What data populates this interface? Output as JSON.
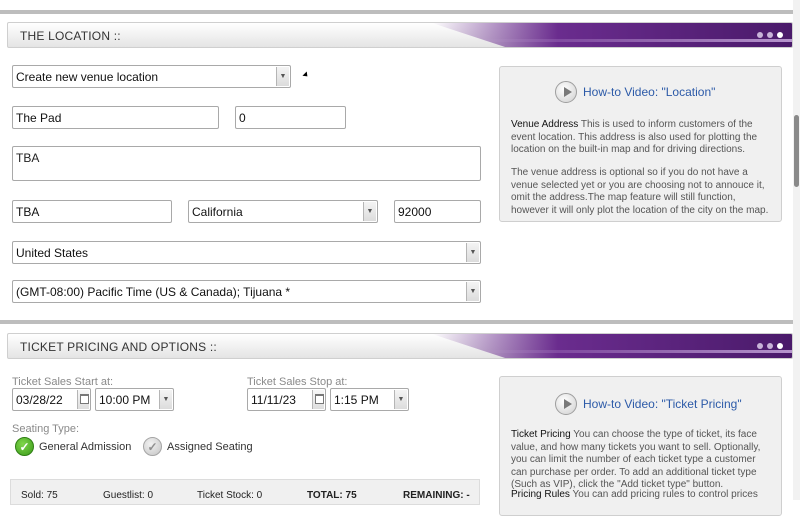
{
  "location": {
    "title": "THE LOCATION ::",
    "venue_select": "Create new venue location",
    "venue_name": "The Pad",
    "capacity": "0",
    "address": "TBA",
    "city": "TBA",
    "state": "California",
    "zip": "92000",
    "country": "United States",
    "timezone": "(GMT-08:00) Pacific Time (US & Canada); Tijuana *",
    "help": {
      "video_label": "How-to Video: \"Location\"",
      "para1_term": "Venue Address",
      "para1_text": " This is used to inform customers of the event location. This address is also used for plotting the location on the built-in map and for driving directions.",
      "para2_text": "The venue address is optional so if you do not have a venue selected yet or you are choosing not to annouce it, omit the address.The map feature will still function, however it will only plot the location of the city on the map."
    }
  },
  "pricing": {
    "title": "TICKET PRICING AND OPTIONS ::",
    "start_label": "Ticket Sales Start at:",
    "start_date": "03/28/22",
    "start_time": "10:00 PM",
    "stop_label": "Ticket Sales Stop at:",
    "stop_date": "11/11/23",
    "stop_time": "1:15 PM",
    "seating_label": "Seating Type:",
    "general_admission": "General Admission",
    "assigned_seating": "Assigned Seating",
    "selected_seating": "General Admission",
    "stats": {
      "sold": "Sold: 75",
      "guestlist": "Guestlist: 0",
      "stock": "Ticket Stock: 0",
      "total": "TOTAL: 75",
      "remaining": "REMAINING: -"
    },
    "help": {
      "video_label": "How-to Video: \"Ticket Pricing\"",
      "para1_term": "Ticket Pricing",
      "para1_text": " You can choose the type of ticket, its face value, and how many tickets you want to sell. Optionally, you can limit the number of each ticket type a customer can purchase per order. To add an additional ticket type (Such as VIP), click the \"Add ticket type\" button.",
      "para2_term": "Pricing Rules",
      "para2_text": " You can add pricing rules to control prices"
    }
  },
  "icons": {
    "select_arrow": "chevron-down-icon",
    "calendar": "calendar-icon",
    "play": "play-icon",
    "check": "check-icon"
  },
  "colors": {
    "header_accent": "#5b2685",
    "link": "#2c5aa8",
    "selected_radio": "#3a9a1a"
  }
}
